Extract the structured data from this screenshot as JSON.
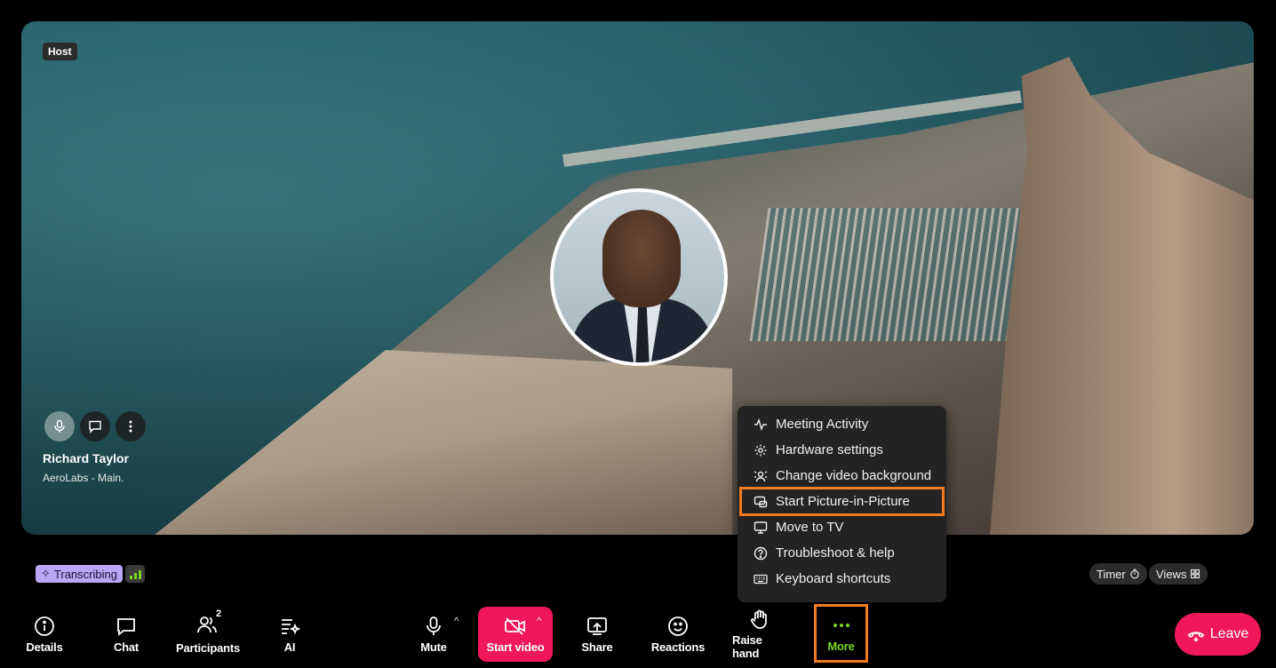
{
  "stage": {
    "host_badge": "Host",
    "participant_name": "Richard Taylor",
    "participant_sub": "AeroLabs - Main."
  },
  "more_menu": {
    "items": [
      {
        "label": "Meeting Activity",
        "icon": "activity-icon"
      },
      {
        "label": "Hardware settings",
        "icon": "gear-icon"
      },
      {
        "label": "Change video background",
        "icon": "background-icon"
      },
      {
        "label": "Start Picture-in-Picture",
        "icon": "pip-icon",
        "highlighted": true
      },
      {
        "label": "Move to TV",
        "icon": "monitor-icon"
      },
      {
        "label": "Troubleshoot & help",
        "icon": "help-icon"
      },
      {
        "label": "Keyboard shortcuts",
        "icon": "keyboard-icon"
      }
    ]
  },
  "status": {
    "transcribing": "Transcribing",
    "timer": "Timer",
    "views": "Views"
  },
  "toolbar": {
    "details": "Details",
    "chat": "Chat",
    "participants": "Participants",
    "participants_count": "2",
    "ai": "AI",
    "mute": "Mute",
    "start_video": "Start video",
    "share": "Share",
    "reactions": "Reactions",
    "raise_hand": "Raise hand",
    "more": "More",
    "leave": "Leave"
  },
  "colors": {
    "accent_red": "#f0185a",
    "highlight_orange": "#f47a20",
    "more_green": "#7ed321",
    "transcribing_bg": "#b9a6f5"
  }
}
